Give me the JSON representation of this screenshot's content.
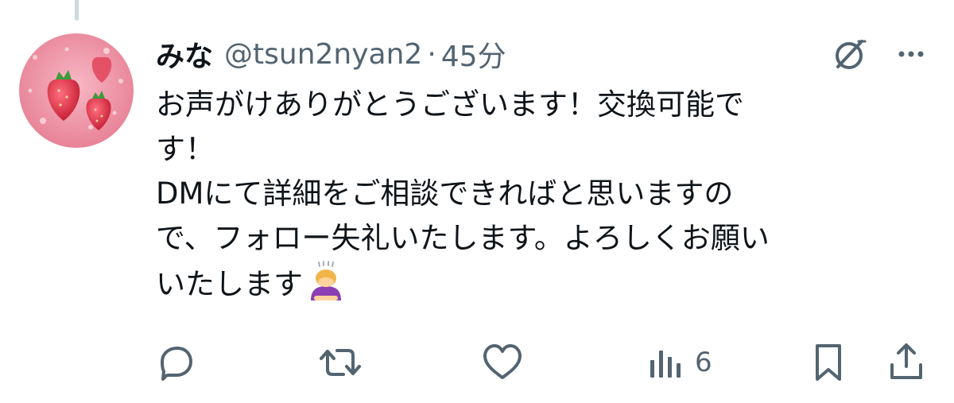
{
  "user": {
    "display_name": "みな",
    "handle": "@tsun2nyan2",
    "separator": "·",
    "timestamp": "45分"
  },
  "tweet": {
    "lines": [
      "お声がけありがとうございます！交換可能で",
      "す！",
      "DMにて詳細をご相談できればと思いますの",
      "で、フォロー失礼いたします。よろしくお願い",
      "いたします"
    ],
    "emoji": "person-bowing-emoji"
  },
  "actions": {
    "views_count": "6"
  },
  "colors": {
    "text": "#0f1419",
    "secondary": "#536471",
    "thread_line": "#cfd9de"
  },
  "icons": [
    "grok-icon",
    "more-icon",
    "reply-icon",
    "retweet-icon",
    "like-icon",
    "views-icon",
    "bookmark-icon",
    "share-icon"
  ]
}
